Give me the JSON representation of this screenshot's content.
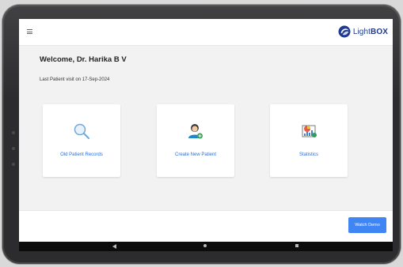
{
  "header": {
    "menu_icon": "hamburger-menu-icon",
    "logo": {
      "text_light": "Light",
      "text_bold": "BOX",
      "icon": "lightbox-logo-icon",
      "brand_color": "#1f3a8f"
    }
  },
  "main": {
    "welcome": "Welcome, Dr. Harika B V",
    "last_visit": "Last Patient visit on 17-Sep-2024",
    "cards": [
      {
        "label": "Old Patient Records",
        "icon": "search-icon"
      },
      {
        "label": "Create New Patient",
        "icon": "add-patient-icon"
      },
      {
        "label": "Statistics",
        "icon": "statistics-icon"
      }
    ]
  },
  "footer": {
    "watch_demo_label": "Watch Demo",
    "accent": "#3f86f4"
  },
  "navbar": {
    "back_icon": "back-triangle-icon",
    "home_icon": "home-circle-icon",
    "recent_icon": "recent-square-icon"
  }
}
